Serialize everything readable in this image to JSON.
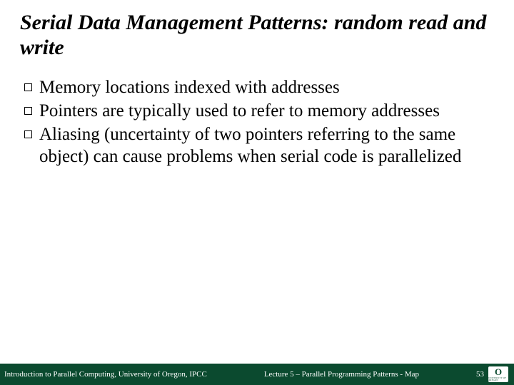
{
  "title": "Serial Data Management Patterns: random read and write",
  "bullets": [
    "Memory locations indexed with addresses",
    "Pointers are typically used to refer to memory addresses",
    "Aliasing (uncertainty of two pointers referring to the same object) can cause problems when serial code is parallelized"
  ],
  "footer": {
    "left": "Introduction to Parallel Computing, University of Oregon, IPCC",
    "center": "Lecture 5 – Parallel Programming Patterns - Map",
    "page": "53",
    "logo_letter": "O",
    "logo_caption": "UNIVERSITY OF OREGON"
  }
}
